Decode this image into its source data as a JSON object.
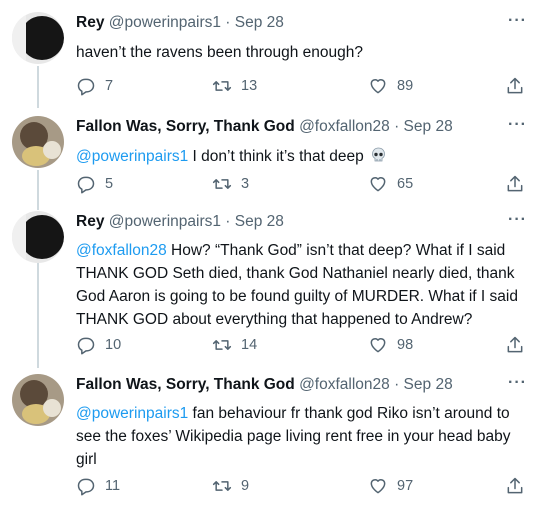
{
  "tweets": [
    {
      "name": "Rey",
      "handle": "@powerinpairs1",
      "date": "· Sep 28",
      "mention": "",
      "text": "haven’t the ravens been through enough?",
      "replies": "7",
      "retweets": "13",
      "likes": "89"
    },
    {
      "name": "Fallon Was, Sorry, Thank God",
      "handle": "@foxfallon28",
      "date": "· Sep 28",
      "mention": "@powerinpairs1",
      "text": " I don’t think it’s that deep",
      "emoji": "skull",
      "replies": "5",
      "retweets": "3",
      "likes": "65"
    },
    {
      "name": "Rey",
      "handle": "@powerinpairs1",
      "date": "· Sep 28",
      "mention": "@foxfallon28",
      "text": " How? “Thank God” isn’t that deep? What if I said THANK GOD Seth died, thank God Nathaniel nearly died, thank God Aaron is going to be found guilty of MURDER. What if I said THANK GOD about everything that happened to Andrew?",
      "replies": "10",
      "retweets": "14",
      "likes": "98"
    },
    {
      "name": "Fallon Was, Sorry, Thank God",
      "handle": "@foxfallon28",
      "date": "· Sep 28",
      "mention": "@powerinpairs1",
      "text": " fan behaviour fr thank god Riko isn’t around to see the foxes’ Wikipedia page living rent free in your head baby girl",
      "replies": "11",
      "retweets": "9",
      "likes": "97"
    }
  ],
  "more_label": "···",
  "colors": {
    "link": "#1d9bf0",
    "secondary": "#536471",
    "thread_line": "#cfd9de"
  },
  "icons": {
    "reply": "reply-icon",
    "retweet": "retweet-icon",
    "like": "heart-icon",
    "share": "share-icon"
  }
}
